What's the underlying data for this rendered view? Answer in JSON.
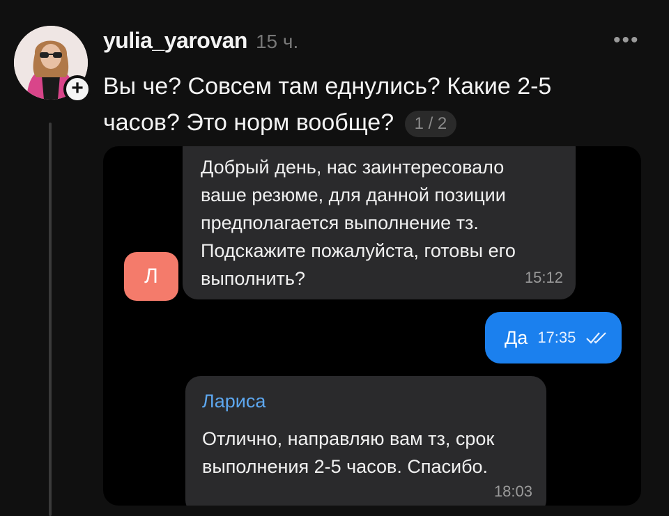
{
  "post": {
    "username": "yulia_yarovan",
    "time": "15 ч.",
    "text": "Вы че? Совсем там еднулись? Какие 2-5 часов? Это норм вообще?",
    "pager": "1 / 2",
    "more_icon": "ellipsis-icon",
    "add_icon": "plus-icon"
  },
  "chat": {
    "avatar_letter": "Л",
    "messages": [
      {
        "text": "Добрый день, нас заинтересовало\nваше резюме, для данной позиции\nпредполагается выполнение тз.\nПодскажите пожалуйста, готовы его\nвыполнить?",
        "time": "15:12"
      },
      {
        "text": "Да",
        "time": "17:35"
      },
      {
        "sender": "Лариса",
        "text": "Отлично, направляю вам тз, срок\nвыполнения 2-5 часов. Спасибо.",
        "time": "18:03"
      }
    ]
  },
  "colors": {
    "background": "#101010",
    "incoming_bubble": "#2a2a2c",
    "outgoing_bubble": "#1b80ee",
    "sender_name": "#5da7ef",
    "letter_avatar": "#f47b6b"
  }
}
